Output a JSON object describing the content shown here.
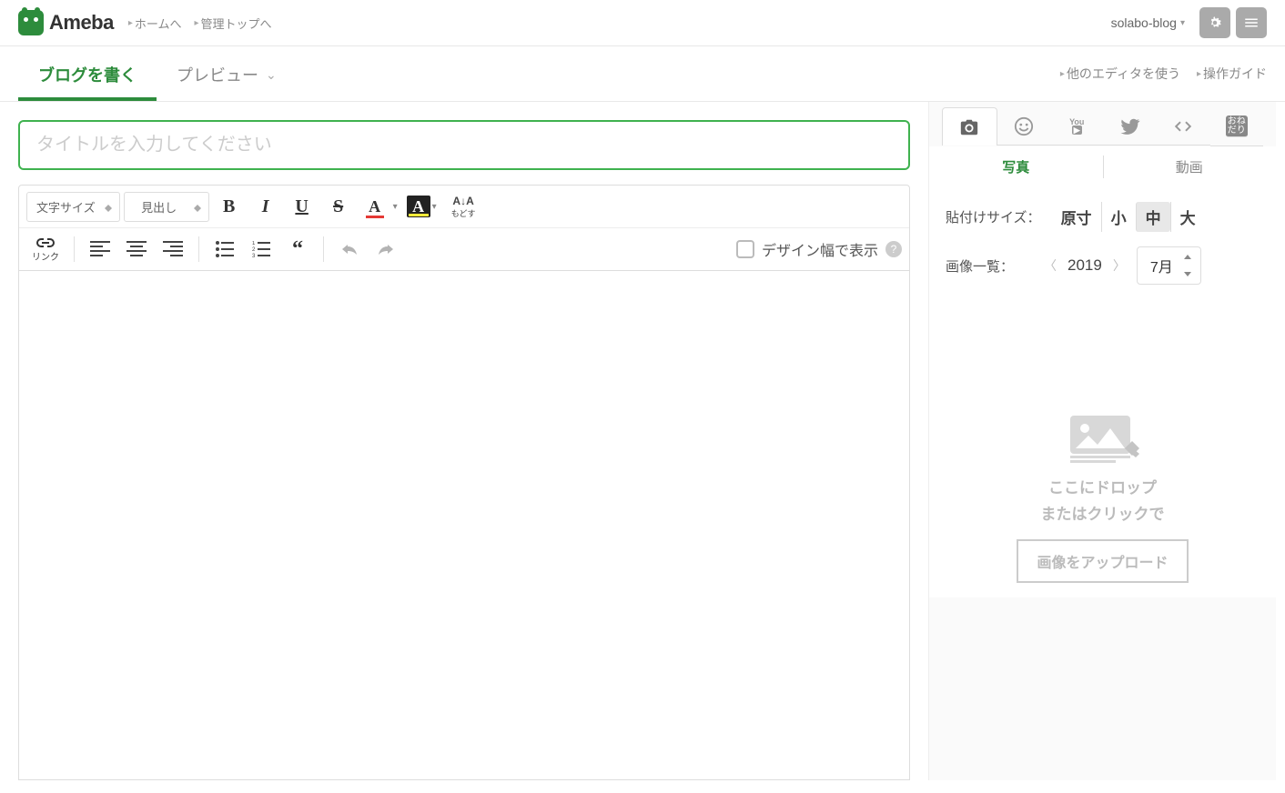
{
  "header": {
    "brand": "Ameba",
    "nav": [
      "ホームへ",
      "管理トップへ"
    ],
    "user": "solabo-blog"
  },
  "tabs": {
    "write": "ブログを書く",
    "preview": "プレビュー",
    "other_editor": "他のエディタを使う",
    "guide": "操作ガイド"
  },
  "title_placeholder": "タイトルを入力してください",
  "toolbar": {
    "font_size": "文字サイズ",
    "heading": "見出し",
    "reset_top": "A↓A",
    "reset_label": "もどす",
    "link_label": "リンク",
    "design_width": "デザイン幅で表示"
  },
  "side": {
    "photo_tab": "写真",
    "video_tab": "動画",
    "paste_size_label": "貼付けサイズ：",
    "sizes": {
      "orig": "原寸",
      "s": "小",
      "m": "中",
      "l": "大"
    },
    "image_list_label": "画像一覧：",
    "year": "2019",
    "month": "7月",
    "drop_line1": "ここにドロップ",
    "drop_line2": "またはクリックで",
    "upload_btn": "画像をアップロード"
  }
}
